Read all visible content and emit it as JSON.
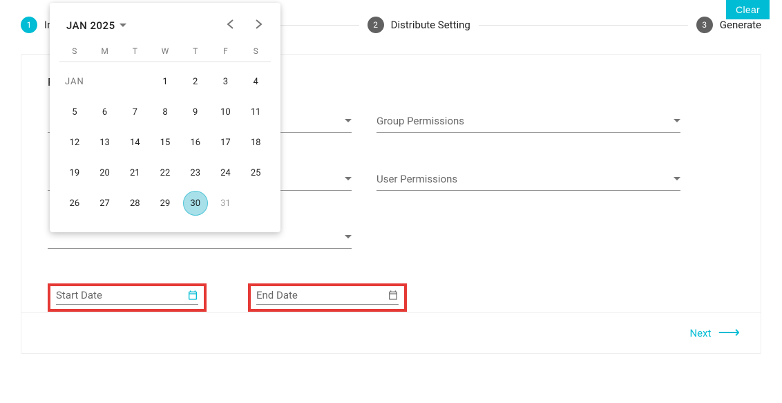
{
  "clear_label": "Clear",
  "stepper": {
    "steps": [
      {
        "num": "1",
        "label": "Input Report Settings"
      },
      {
        "num": "2",
        "label": "Distribute Setting"
      },
      {
        "num": "3",
        "label": "Generate"
      }
    ]
  },
  "card": {
    "title": "Report Settings",
    "fields": {
      "group_permissions": "Group Permissions",
      "user_permissions": "User Permissions",
      "start_date": "Start Date",
      "end_date": "End Date",
      "hidden_left_1": "",
      "hidden_left_2": "",
      "hidden_left_3": ""
    },
    "next_label": "Next"
  },
  "calendar": {
    "month_label": "JAN 2025",
    "dow": [
      "S",
      "M",
      "T",
      "W",
      "T",
      "F",
      "S"
    ],
    "month_short": "JAN",
    "weeks": [
      [
        "",
        "",
        "",
        "1",
        "2",
        "3",
        "4"
      ],
      [
        "5",
        "6",
        "7",
        "8",
        "9",
        "10",
        "11"
      ],
      [
        "12",
        "13",
        "14",
        "15",
        "16",
        "17",
        "18"
      ],
      [
        "19",
        "20",
        "21",
        "22",
        "23",
        "24",
        "25"
      ],
      [
        "26",
        "27",
        "28",
        "29",
        "30",
        "31",
        ""
      ]
    ],
    "selected_day": "30",
    "disabled_days": [
      "31"
    ]
  }
}
